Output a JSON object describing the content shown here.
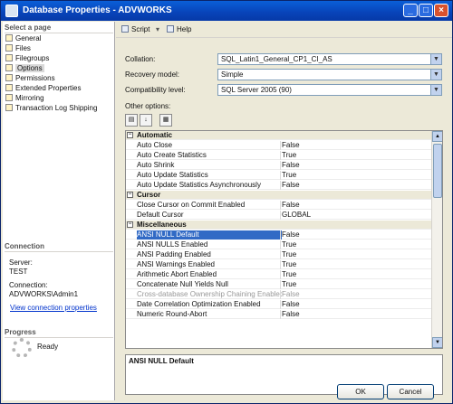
{
  "window": {
    "title": "Database Properties - ADVWORKS"
  },
  "nav": {
    "header": "Select a page",
    "items": [
      {
        "label": "General"
      },
      {
        "label": "Files"
      },
      {
        "label": "Filegroups"
      },
      {
        "label": "Options"
      },
      {
        "label": "Permissions"
      },
      {
        "label": "Extended Properties"
      },
      {
        "label": "Mirroring"
      },
      {
        "label": "Transaction Log Shipping"
      }
    ]
  },
  "connection": {
    "header": "Connection",
    "server_label": "Server:",
    "server": "TEST",
    "connection_label": "Connection:",
    "connection": "ADVWORKS\\Admin1",
    "view_link": "View connection properties"
  },
  "progress": {
    "header": "Progress",
    "status": "Ready"
  },
  "toolbar": {
    "script": "Script",
    "help": "Help"
  },
  "fields": {
    "collation_label": "Collation:",
    "collation_value": "SQL_Latin1_General_CP1_CI_AS",
    "recovery_label": "Recovery model:",
    "recovery_value": "Simple",
    "compat_label": "Compatibility level:",
    "compat_value": "SQL Server 2005 (90)",
    "other_label": "Other options:"
  },
  "grid": {
    "rows": [
      {
        "type": "cat",
        "name": "Automatic"
      },
      {
        "name": "Auto Close",
        "value": "False"
      },
      {
        "name": "Auto Create Statistics",
        "value": "True"
      },
      {
        "name": "Auto Shrink",
        "value": "False"
      },
      {
        "name": "Auto Update Statistics",
        "value": "True"
      },
      {
        "name": "Auto Update Statistics Asynchronously",
        "value": "False"
      },
      {
        "type": "cat",
        "name": "Cursor"
      },
      {
        "name": "Close Cursor on Commit Enabled",
        "value": "False"
      },
      {
        "name": "Default Cursor",
        "value": "GLOBAL"
      },
      {
        "type": "cat",
        "name": "Miscellaneous"
      },
      {
        "name": "ANSI NULL Default",
        "value": "False",
        "selected": true
      },
      {
        "name": "ANSI NULLS Enabled",
        "value": "True"
      },
      {
        "name": "ANSI Padding Enabled",
        "value": "True"
      },
      {
        "name": "ANSI Warnings Enabled",
        "value": "True"
      },
      {
        "name": "Arithmetic Abort Enabled",
        "value": "True"
      },
      {
        "name": "Concatenate Null Yields Null",
        "value": "True"
      },
      {
        "name": "Cross-database Ownership Chaining Enabled",
        "value": "False",
        "disabled": true
      },
      {
        "name": "Date Correlation Optimization Enabled",
        "value": "False"
      },
      {
        "name": "Numeric Round-Abort",
        "value": "False"
      }
    ]
  },
  "description": {
    "title": "ANSI NULL Default"
  },
  "buttons": {
    "ok": "OK",
    "cancel": "Cancel"
  }
}
